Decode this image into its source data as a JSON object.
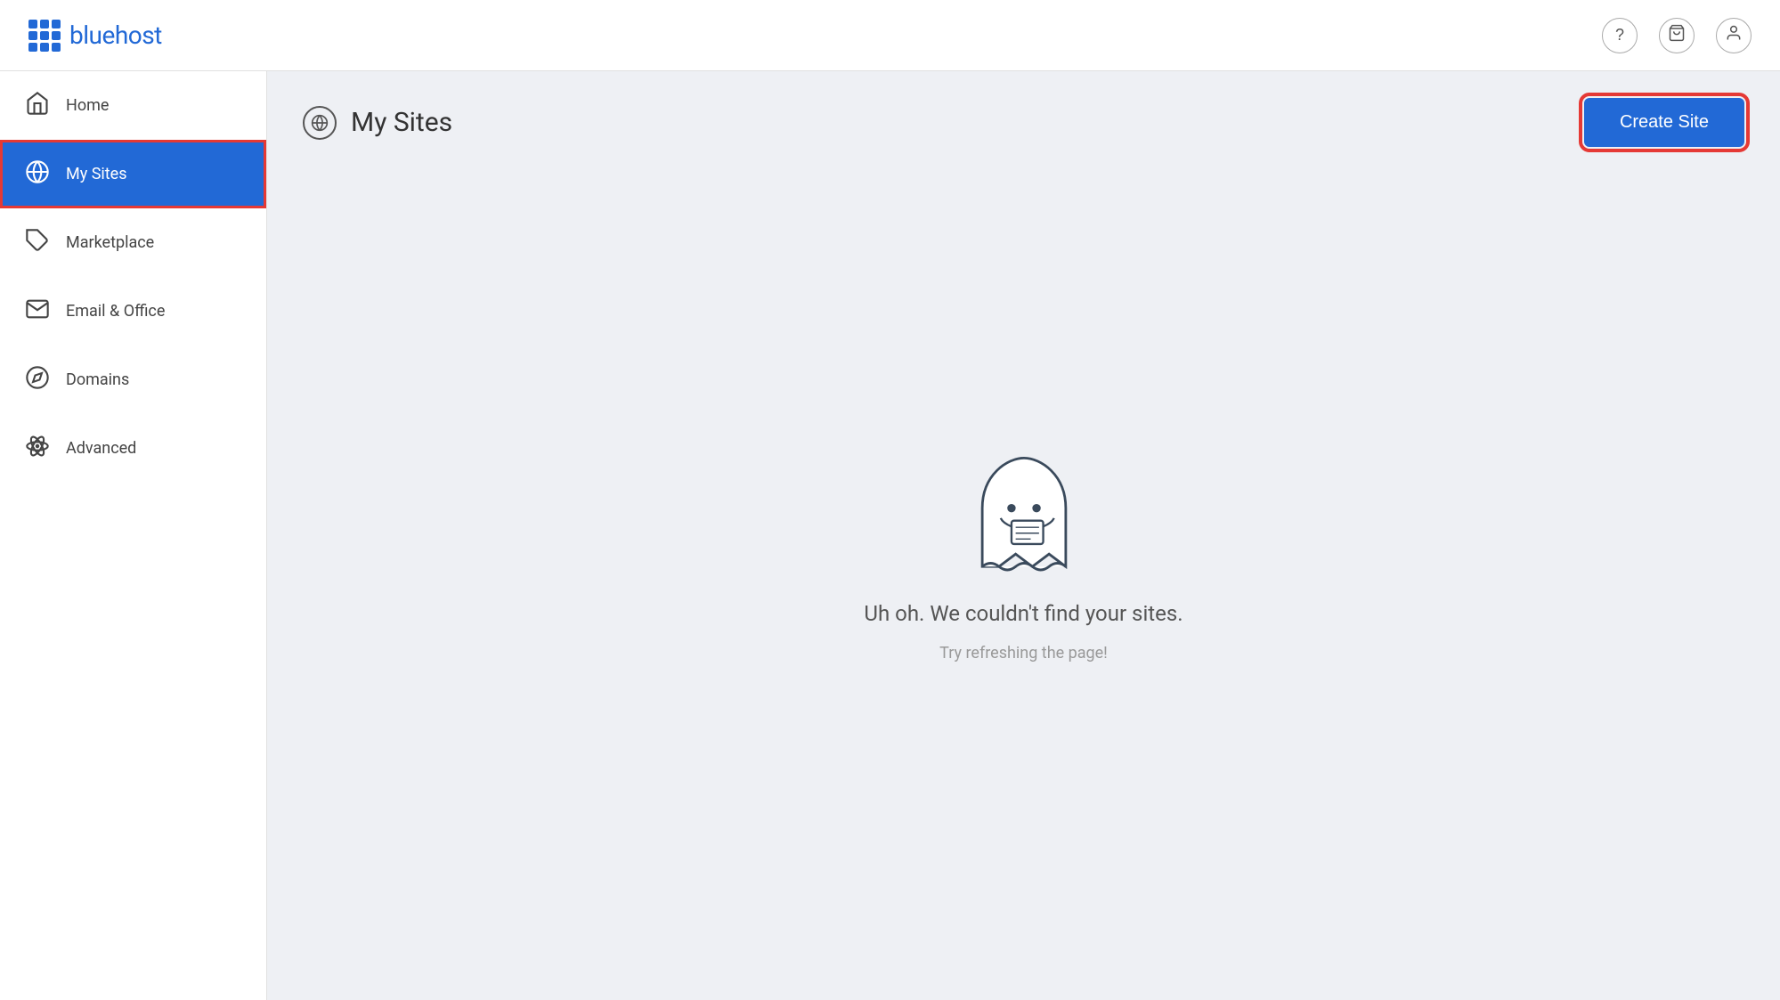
{
  "header": {
    "logo_text": "bluehost",
    "icon_question": "?",
    "icon_cart": "🛒",
    "icon_user": "👤"
  },
  "sidebar": {
    "items": [
      {
        "id": "home",
        "label": "Home",
        "icon": "home"
      },
      {
        "id": "my-sites",
        "label": "My Sites",
        "icon": "wordpress",
        "active": true
      },
      {
        "id": "marketplace",
        "label": "Marketplace",
        "icon": "tag"
      },
      {
        "id": "email-office",
        "label": "Email & Office",
        "icon": "mail"
      },
      {
        "id": "domains",
        "label": "Domains",
        "icon": "compass"
      },
      {
        "id": "advanced",
        "label": "Advanced",
        "icon": "atom"
      }
    ]
  },
  "main": {
    "title": "My Sites",
    "create_site_label": "Create Site",
    "empty_title": "Uh oh. We couldn't find your sites.",
    "empty_subtitle": "Try refreshing the page!"
  }
}
